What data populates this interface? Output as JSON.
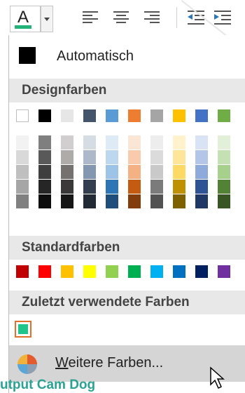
{
  "toolbar": {
    "font_color_letter": "A",
    "font_color_bar": "#21b378"
  },
  "menu": {
    "automatic_label": "Automatisch",
    "theme_header": "Designfarben",
    "standard_header": "Standardfarben",
    "recent_header": "Zuletzt verwendete Farben",
    "more_colors_label": {
      "accel": "W",
      "rest": "eitere Farben..."
    }
  },
  "theme_colors": {
    "top": [
      "#ffffff",
      "#000000",
      "#e7e6e6",
      "#44546a",
      "#5b9bd5",
      "#ed7d31",
      "#a5a5a5",
      "#ffc000",
      "#4472c4",
      "#70ad47"
    ],
    "shades": [
      [
        "#f2f2f2",
        "#d9d9d9",
        "#bfbfbf",
        "#a6a6a6",
        "#808080"
      ],
      [
        "#7f7f7f",
        "#595959",
        "#3f3f3f",
        "#262626",
        "#0d0d0d"
      ],
      [
        "#d0cece",
        "#aeabab",
        "#757171",
        "#3a3838",
        "#171616"
      ],
      [
        "#d6dce4",
        "#adb9ca",
        "#8497b0",
        "#333f4f",
        "#222a35"
      ],
      [
        "#deebf6",
        "#bdd7ee",
        "#9dc3e6",
        "#2e75b5",
        "#1e4e79"
      ],
      [
        "#fbe5d5",
        "#f7cbac",
        "#f4b183",
        "#c55a11",
        "#833c0b"
      ],
      [
        "#ededed",
        "#dbdbdb",
        "#c9c9c9",
        "#7b7b7b",
        "#525252"
      ],
      [
        "#fff2cc",
        "#fee599",
        "#ffd966",
        "#bf9000",
        "#7f6000"
      ],
      [
        "#dae3f3",
        "#b4c6e7",
        "#8eaadb",
        "#2f5496",
        "#1f3864"
      ],
      [
        "#e2efd9",
        "#c5e0b3",
        "#a8d08d",
        "#538135",
        "#375623"
      ]
    ]
  },
  "standard_colors": [
    "#c00000",
    "#ff0000",
    "#ffc000",
    "#ffff00",
    "#92d050",
    "#00b050",
    "#00b0f0",
    "#0070c0",
    "#002060",
    "#7030a0"
  ],
  "recent_colors": [
    "#21c48a"
  ],
  "background_text": "utput Cam Dog"
}
